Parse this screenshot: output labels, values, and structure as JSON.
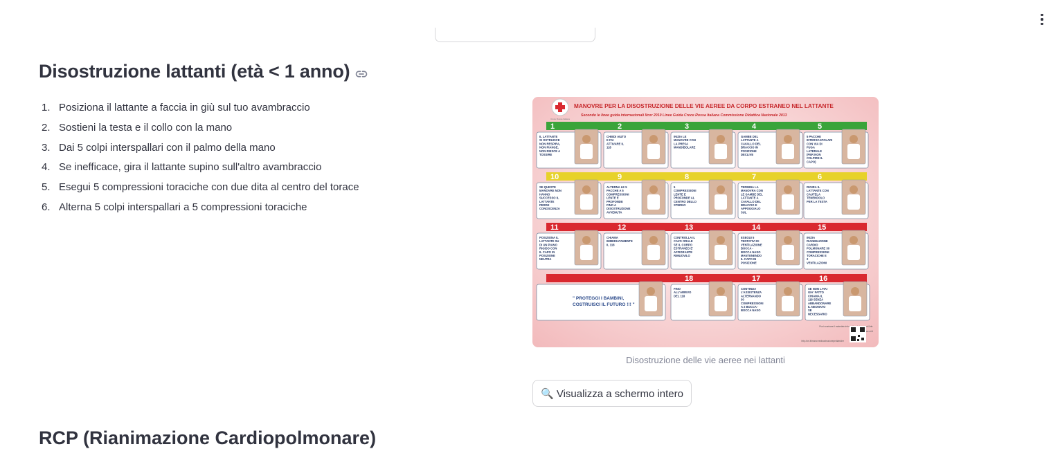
{
  "section": {
    "title": "Disostruzione lattanti (età < 1 anno)",
    "link_icon": "link-icon"
  },
  "steps": [
    {
      "num": "1.",
      "text": "Posiziona il lattante a faccia in giù sul tuo avambraccio"
    },
    {
      "num": "2.",
      "text": "Sostieni la testa e il collo con la mano"
    },
    {
      "num": "3.",
      "text": "Dai 5 colpi interspallari con il palmo della mano"
    },
    {
      "num": "4.",
      "text": "Se inefficace, gira il lattante supino sull'altro avambraccio"
    },
    {
      "num": "5.",
      "text": "Esegui 5 compressioni toraciche con due dita al centro del torace"
    },
    {
      "num": "6.",
      "text": "Alterna 5 colpi interspallari a 5 compressioni toraciche"
    }
  ],
  "poster": {
    "title": "MANOVRE PER LA DISOSTRUZIONE DELLE VIE AEREE DA CORPO ESTRANEO NEL LATTANTE",
    "subtitle": "Secondo le linee guida internazionali Ilcor 2010 Linee Guida Croce Rossa Italiana  Commissione Didattica Nazionale 2013",
    "rows": [
      {
        "color": "#3aa43a",
        "steps": [
          {
            "n": "1",
            "text": "IL LATTANTE SI OSTRUISCE NON RESPIRA, NON PIANGE, NON RIESCE A TOSSIRE"
          },
          {
            "n": "2",
            "text": "CHIEDI AIUTO E FAI ATTIVARE IL 118"
          },
          {
            "n": "3",
            "text": "INIZIA LE MANOVRE CON LA PRESA MANDIBOLARE"
          },
          {
            "n": "4",
            "text": "GAMBE DEL LATTANTE A CAVALLO DEL BRACCIO IN POSIZIONE DECLIVE"
          },
          {
            "n": "5",
            "text": "5 PACCHE INTERSCAPOLARI CON VIA DI FUGA LATERALE (PER NON COLPIRE IL CAPO)"
          }
        ]
      },
      {
        "color": "#e7d22a",
        "steps": [
          {
            "n": "10",
            "text": "SE QUESTE MANOVRE NON HANNO SUCCESSO IL LATTANTE PERDE CONOSCENZA"
          },
          {
            "n": "9",
            "text": "ALTERNA LE 5 PACCHE A 5 COMPRESSIONI LENTE E PROFONDE FINO A DISOSTRUZIONE AVVENUTA"
          },
          {
            "n": "8",
            "text": "5 COMPRESSIONI LENTE E PROFONDE AL CENTRO DELLO STERNO"
          },
          {
            "n": "7",
            "text": "TERMINA LA MANOVRA CON LE GAMBE DEL LATTANTE A CAVALLO DEL BRACCIO E APPOGGIALO SUL GINOCCHIO"
          },
          {
            "n": "6",
            "text": "RIGIRA IL LATTANTE CON CAUTELA TENENDOLO PER LA TESTA"
          }
        ]
      },
      {
        "color": "#d9282f",
        "steps": [
          {
            "n": "11",
            "text": "POSIZIONA IL LATTANTE SU DI UN PIANO RIGIDO CON IL CAPO IN POSIZIONE NEUTRA"
          },
          {
            "n": "12",
            "text": "CHIAMA IMMEDIATAMENTE IL 118"
          },
          {
            "n": "13",
            "text": "CONTROLLA IL CAVO ORALE SE IL CORPO ESTRANEO E' AFFIORANTE RIMUOVILO"
          },
          {
            "n": "14",
            "text": "ESEGUI 5 TENTATIVI DI VENTILAZIONE BOCCA - BOCCA NASO MANTENENDO IL CAPO IN POSIZIONE NEUTRA"
          },
          {
            "n": "15",
            "text": "INIZIA RIANIMAZIONE CARDIO POLMONARE 30 COMPRESSIONI TORACICHE E 2 VENTILAZIONI BOCCA - BOCCA NASO"
          }
        ]
      },
      {
        "color": "#d9282f",
        "steps": [
          {
            "n": "",
            "text": "\" PROTEGGI I BAMBINI, COSTRUISCI IL FUTURO !!! \""
          },
          {
            "n": "18",
            "text": "FINO ALL'ARRIVO DEL 118"
          },
          {
            "n": "17",
            "text": "CONTINUA L'ASSISTENZA ALTERNANDO 30 COMPRESSIONI A 2 BOCCA - BOCCA NASO"
          },
          {
            "n": "16",
            "text": "SE NON L'HAI GIA' FATTO CHIAMA IL 118 SENZA ABBANDONARE IL NEONATO SE NECESSARIO PORTALO CON TE"
          }
        ]
      }
    ],
    "footer_lines": [
      "Puoi scaricare il materiale informativo dai seguenti link:",
      "www.cri.it",
      "http://cri.it/manovredisostruzionepediatriche"
    ],
    "logo_text": "Croce Rossa Italiana"
  },
  "caption": "Disostruzione delle vie aeree nei lattanti",
  "fullscreen_button": {
    "icon": "magnifier-icon",
    "label": "🔍 Visualizza a schermo intero"
  },
  "next_section": {
    "title": "RCP (Rianimazione Cardiopolmonare)"
  },
  "colors": {
    "text": "#31333f",
    "caption": "#808495",
    "border": "#d6d6d9",
    "poster_bg": "#f4c7c8"
  }
}
